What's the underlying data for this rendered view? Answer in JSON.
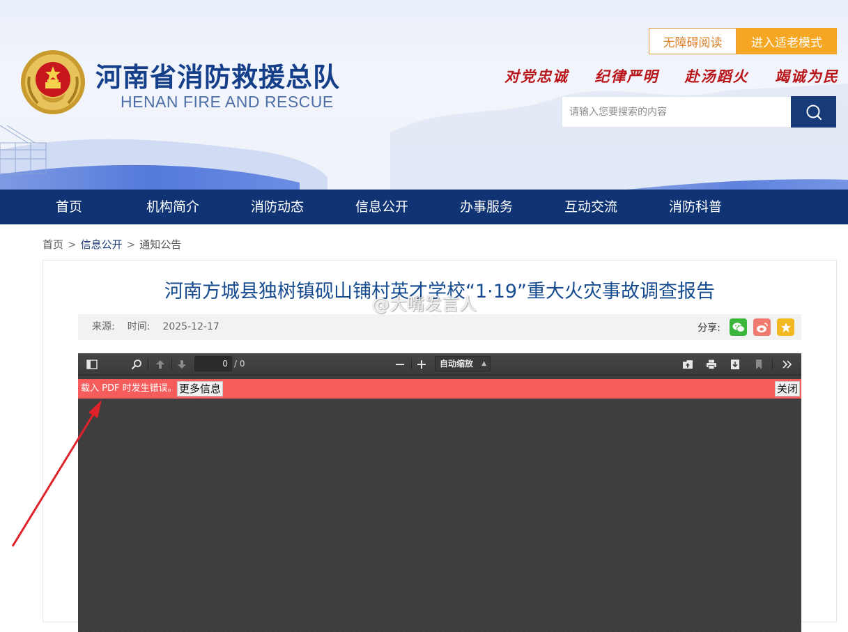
{
  "header": {
    "site_title": "河南省消防救援总队",
    "site_subtitle": "HENAN FIRE AND RESCUE",
    "accessibility_button": "无障碍阅读",
    "elder_mode_button": "进入适老模式",
    "motto": [
      "对党忠诚",
      "纪律严明",
      "赴汤蹈火",
      "竭诚为民"
    ],
    "search_placeholder": "请输入您要搜索的内容",
    "colors": {
      "primary": "#103473",
      "accent": "#f5a623",
      "motto_red": "#b8151a"
    }
  },
  "nav": {
    "items": [
      "首页",
      "机构简介",
      "消防动态",
      "信息公开",
      "办事服务",
      "互动交流",
      "消防科普"
    ]
  },
  "breadcrumb": {
    "home": "首页",
    "section": "信息公开",
    "current": "通知公告",
    "separator": ">"
  },
  "article": {
    "title": "河南方城县独树镇砚山铺村英才学校“1·19”重大火灾事故调查报告",
    "source_label": "来源:",
    "time_label": "时间:",
    "date": "2025-12-17",
    "share_label": "分享:",
    "share_icons": [
      "wechat-icon",
      "weibo-icon",
      "favorite-star-icon"
    ]
  },
  "pdf_viewer": {
    "page_value": "0",
    "page_count": "/ 0",
    "zoom": "自动缩放",
    "error_message": "载入 PDF 时发生错误。",
    "more_info_button": "更多信息",
    "close_button": "关闭",
    "colors": {
      "error_bar": "#f55c5c",
      "viewer_bg": "#3d3d3d"
    }
  },
  "watermark": {
    "text": "@大嘴发言人"
  }
}
